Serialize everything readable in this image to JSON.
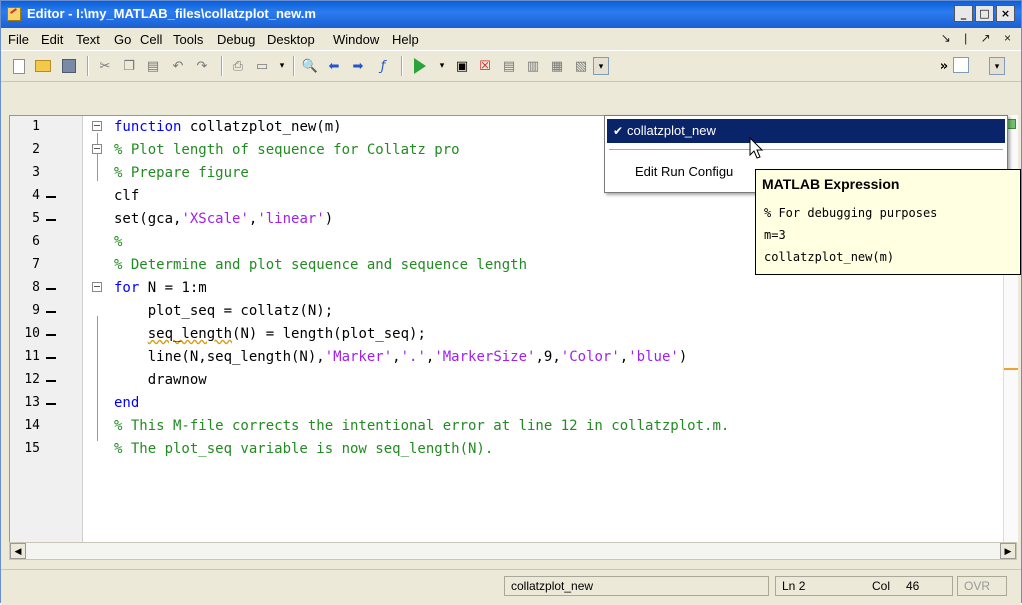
{
  "window": {
    "title": "Editor - I:\\my_MATLAB_files\\collatzplot_new.m",
    "min_label": "_",
    "max_label": "□",
    "close_label": "×"
  },
  "menu": {
    "items": [
      "File",
      "Edit",
      "Text",
      "Go",
      "Cell",
      "Tools",
      "Debug",
      "Desktop",
      "Window",
      "Help"
    ],
    "right_icons": [
      "↘",
      "|",
      "↗",
      "×"
    ]
  },
  "toolbar": {
    "icons": [
      "new-file-icon",
      "open-folder-icon",
      "save-icon",
      "cut-icon",
      "copy-icon",
      "paste-icon",
      "undo-icon",
      "redo-icon",
      "print-icon",
      "comment-icon",
      "find-icon",
      "back-icon",
      "forward-icon",
      "function-icon",
      "run-icon",
      "breakpoint-set-icon",
      "breakpoint-clear-icon",
      "step-icon",
      "step-in-icon",
      "step-out-icon",
      "continue-icon",
      "stack-icon"
    ],
    "overflow_label": "»"
  },
  "editor": {
    "lines": [
      {
        "num": "1"
      },
      {
        "num": "2"
      },
      {
        "num": "3"
      },
      {
        "num": "4"
      },
      {
        "num": "5"
      },
      {
        "num": "6"
      },
      {
        "num": "7"
      },
      {
        "num": "8"
      },
      {
        "num": "9"
      },
      {
        "num": "10"
      },
      {
        "num": "11"
      },
      {
        "num": "12"
      },
      {
        "num": "13"
      },
      {
        "num": "14"
      },
      {
        "num": "15"
      }
    ],
    "code": {
      "l1_kw": "function",
      "l1_rest": " collatzplot_new(m)",
      "l2": "% Plot length of sequence for Collatz pro",
      "l3": "% Prepare figure",
      "l4": "clf",
      "l5_a": "set(gca,",
      "l5_s": "'XScale'",
      "l5_b": ",",
      "l5_s2": "'linear'",
      "l5_c": ")",
      "l6": "%",
      "l7": "% Determine and plot sequence and sequence length",
      "l8_kw": "for",
      "l8_rest": " N = 1:m",
      "l9": "    plot_seq = collatz(N);",
      "l10_a": "    ",
      "l10_sq": "seq_length",
      "l10_b": "(N) = length(plot_seq);",
      "l11_a": "    line(N,seq_length(N),",
      "l11_s1": "'Marker'",
      "l11_b": ",",
      "l11_s2": "'.'",
      "l11_c": ",",
      "l11_s3": "'MarkerSize'",
      "l11_d": ",9,",
      "l11_s4": "'Color'",
      "l11_e": ",",
      "l11_s5": "'blue'",
      "l11_f": ")",
      "l12": "    drawnow",
      "l13": "end",
      "l14": "% This M-file corrects the intentional error at line 12 in collatzplot.m.",
      "l15": "% The plot_seq variable is now seq_length(N)."
    }
  },
  "dropdown": {
    "selected_check": "✔",
    "selected_label": "collatzplot_new",
    "edit_label": "Edit Run Configu"
  },
  "tooltip": {
    "title": "MATLAB Expression",
    "lines": [
      "% For debugging purposes",
      "m=3",
      "collatzplot_new(m)"
    ]
  },
  "status": {
    "function_name": "collatzplot_new",
    "ln_label": "Ln",
    "ln_value": "2",
    "col_label": "Col",
    "col_value": "46",
    "ovr": "OVR"
  },
  "colors": {
    "keyword": "#0000ff",
    "comment": "#228b22",
    "string": "#a020f0",
    "selection": "#0a246a",
    "tooltip_bg": "#ffffe1"
  }
}
